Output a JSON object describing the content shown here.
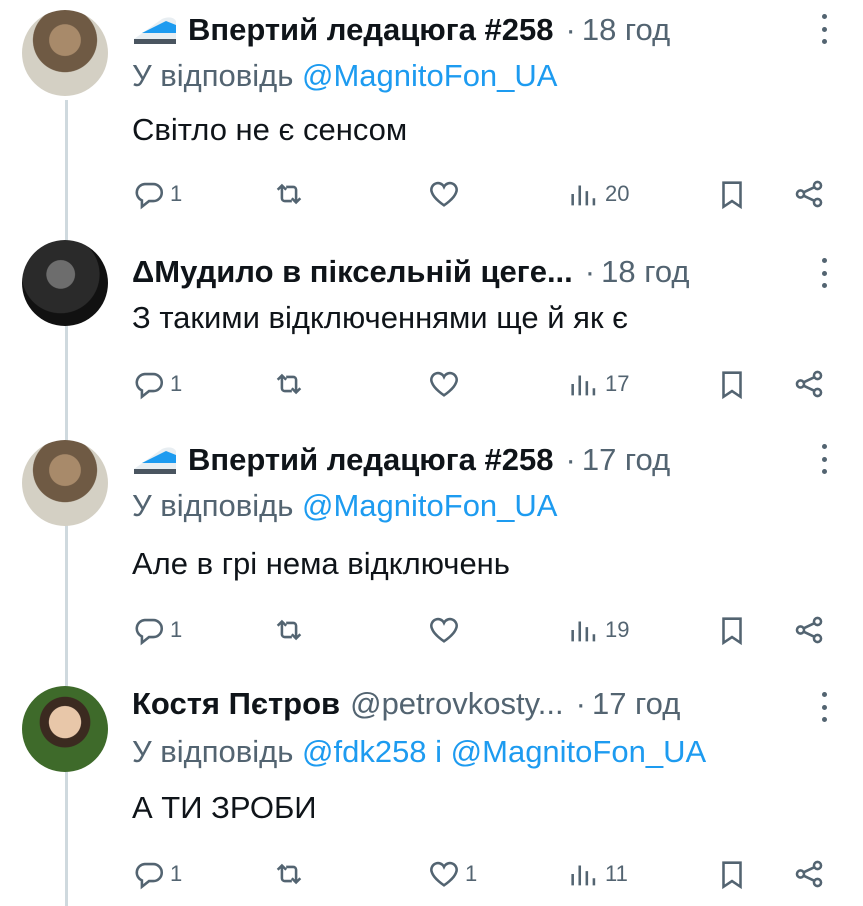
{
  "tweets": [
    {
      "name": "Впертий ледацюга #258",
      "handle": "",
      "time": "18 год",
      "reply_prefix": "У відповідь",
      "reply_to": "@MagnitoFon_UA",
      "text": "Світло не є сенсом",
      "replies": "1",
      "retweets": "",
      "likes": "",
      "views": "20",
      "has_badge": true
    },
    {
      "name": "ΔМудило в піксельній цеге...",
      "handle": "",
      "time": "18 год",
      "reply_prefix": "",
      "reply_to": "",
      "text": "З такими відключеннями ще й як є",
      "replies": "1",
      "retweets": "",
      "likes": "",
      "views": "17",
      "has_badge": false
    },
    {
      "name": "Впертий ледацюга #258",
      "handle": "",
      "time": "17 год",
      "reply_prefix": "У відповідь",
      "reply_to": "@MagnitoFon_UA",
      "text": "Але в грі нема відключень",
      "replies": "1",
      "retweets": "",
      "likes": "",
      "views": "19",
      "has_badge": true
    },
    {
      "name": "Костя Пєтров",
      "handle": "@petrovkosty...",
      "time": "17 год",
      "reply_prefix": "У відповідь",
      "reply_to": "@fdk258 і @MagnitoFon_UA",
      "text": "А ТИ ЗРОБИ",
      "replies": "1",
      "retweets": "",
      "likes": "1",
      "views": "11",
      "has_badge": false
    }
  ],
  "colors": {
    "text": "#0f1419",
    "muted": "#536471",
    "link": "#1d9bf0",
    "thread": "#cfd9de"
  }
}
